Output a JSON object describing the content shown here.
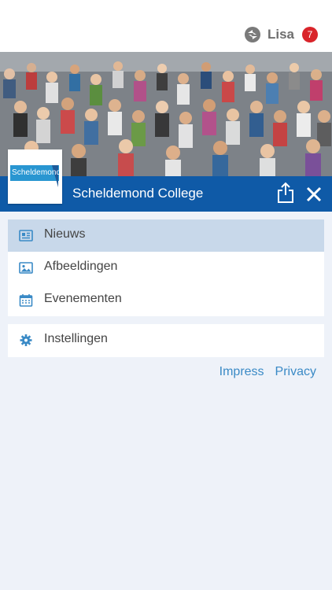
{
  "user": {
    "name": "Lisa",
    "badge_count": "7"
  },
  "school": {
    "name": "Scheldemond College",
    "logo_text": "Scheldemond"
  },
  "menu": {
    "items": [
      {
        "label": "Nieuws",
        "icon": "newspaper-icon",
        "active": true
      },
      {
        "label": "Afbeeldingen",
        "icon": "image-icon",
        "active": false
      },
      {
        "label": "Evenementen",
        "icon": "calendar-icon",
        "active": false
      }
    ],
    "settings_label": "Instellingen"
  },
  "footer": {
    "impress": "Impress",
    "privacy": "Privacy"
  },
  "colors": {
    "brand": "#0f5aa7",
    "active_row": "#c8d8ea",
    "link": "#3a8ac6",
    "badge": "#d9242a",
    "background": "#eef2f9"
  }
}
